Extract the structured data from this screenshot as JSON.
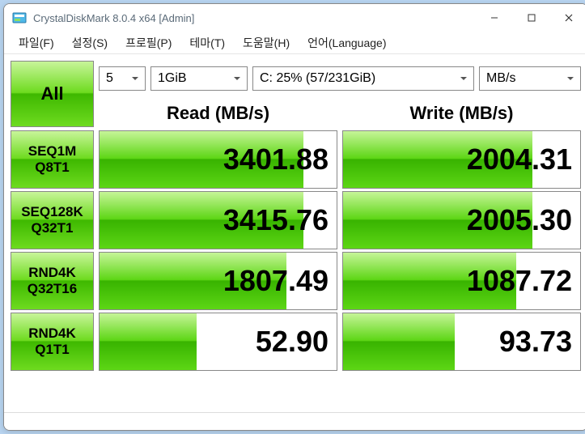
{
  "titlebar": {
    "title": "CrystalDiskMark 8.0.4 x64 [Admin]"
  },
  "menu": {
    "file": "파일(F)",
    "settings": "설정(S)",
    "profile": "프로필(P)",
    "theme": "테마(T)",
    "help": "도움말(H)",
    "language": "언어(Language)"
  },
  "controls": {
    "all_label": "All",
    "count": "5",
    "size": "1GiB",
    "drive": "C: 25% (57/231GiB)",
    "unit": "MB/s"
  },
  "headers": {
    "read": "Read (MB/s)",
    "write": "Write (MB/s)"
  },
  "rows": [
    {
      "label1": "SEQ1M",
      "label2": "Q8T1",
      "read": "3401.88",
      "read_pct": 86,
      "write": "2004.31",
      "write_pct": 80
    },
    {
      "label1": "SEQ128K",
      "label2": "Q32T1",
      "read": "3415.76",
      "read_pct": 86,
      "write": "2005.30",
      "write_pct": 80
    },
    {
      "label1": "RND4K",
      "label2": "Q32T16",
      "read": "1807.49",
      "read_pct": 79,
      "write": "1087.72",
      "write_pct": 73
    },
    {
      "label1": "RND4K",
      "label2": "Q1T1",
      "read": "52.90",
      "read_pct": 41,
      "write": "93.73",
      "write_pct": 47
    }
  ],
  "chart_data": {
    "type": "table",
    "title": "CrystalDiskMark 8.0.4 Benchmark Results",
    "unit": "MB/s",
    "drive": "C: 25% (57/231GiB)",
    "test_size": "1GiB",
    "test_count": 5,
    "series": [
      {
        "name": "Read",
        "values": [
          3401.88,
          3415.76,
          1807.49,
          52.9
        ]
      },
      {
        "name": "Write",
        "values": [
          2004.31,
          2005.3,
          1087.72,
          93.73
        ]
      }
    ],
    "categories": [
      "SEQ1M Q8T1",
      "SEQ128K Q32T1",
      "RND4K Q32T16",
      "RND4K Q1T1"
    ]
  }
}
